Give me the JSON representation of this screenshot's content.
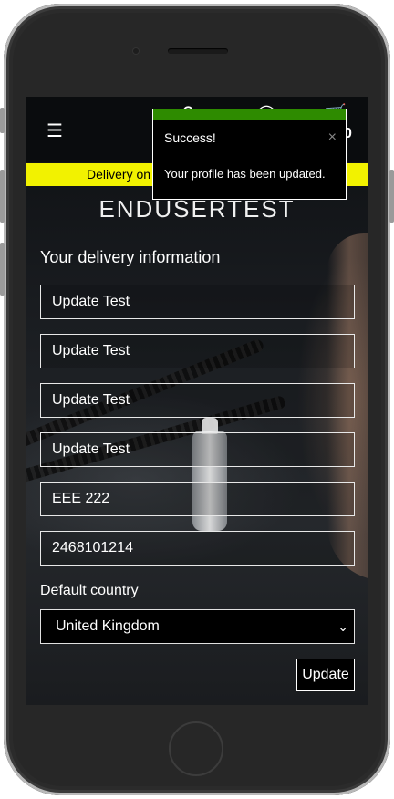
{
  "header": {
    "menu_icon": "hamburger-icon",
    "cart_count": "0",
    "banner_text": "Delivery on orders over £50 is free!"
  },
  "page": {
    "title": "ENDUSERTEST",
    "section_heading": "Your delivery information"
  },
  "form": {
    "fields": [
      "Update Test",
      "Update Test",
      "Update Test",
      "Update Test",
      "EEE 222",
      "2468101214"
    ],
    "country_label": "Default country",
    "country_value": "United Kingdom",
    "update_label": "Update"
  },
  "toast": {
    "title": "Success!",
    "close_glyph": "×",
    "message": "Your profile has been updated.",
    "accent_color": "#2e8b00"
  }
}
